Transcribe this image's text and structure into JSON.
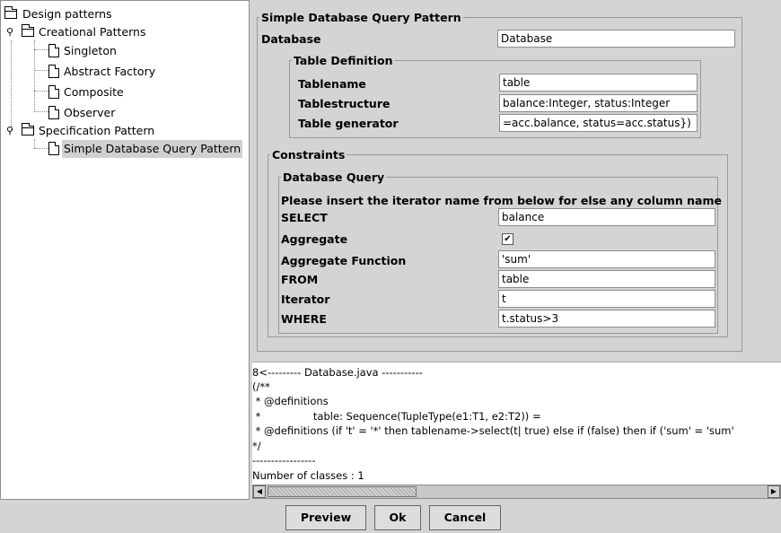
{
  "tree": {
    "items": [
      {
        "label": "Design patterns"
      },
      {
        "label": "Creational Patterns"
      },
      {
        "label": "Singleton"
      },
      {
        "label": "Abstract Factory"
      },
      {
        "label": "Composite"
      },
      {
        "label": "Observer"
      },
      {
        "label": "Specification Pattern"
      },
      {
        "label": "Simple Database Query Pattern"
      }
    ]
  },
  "form": {
    "title": "Simple Database Query Pattern",
    "database_label": "Database",
    "database_value": "Database",
    "table_def": {
      "title": "Table Definition",
      "tablename_label": "Tablename",
      "tablename_value": "table",
      "tablestructure_label": "Tablestructure",
      "tablestructure_value": "balance:Integer, status:Integer",
      "generator_label": "Table generator",
      "generator_value": "=acc.balance, status=acc.status})"
    },
    "constraints": {
      "title": "Constraints",
      "query_title": "Database Query",
      "instruction": "Please insert the iterator name from below for  else any column name",
      "select_label": "SELECT",
      "select_value": "balance",
      "aggregate_label": "Aggregate",
      "aggregate_checked": "✔",
      "aggfunc_label": "Aggregate Function",
      "aggfunc_value": "'sum'",
      "from_label": "FROM",
      "from_value": "table",
      "iterator_label": "Iterator",
      "iterator_value": "t",
      "where_label": "WHERE",
      "where_value": "t.status>3"
    }
  },
  "output": {
    "lines": [
      "8<--------- Database.java -----------",
      "(/**",
      " * @definitions",
      " *                table: Sequence(TupleType(e1:T1, e2:T2)) =",
      " * @definitions (if 't' = '*' then tablename->select(t| true) else if (false) then if ('sum' = 'sum'",
      "*/",
      "-----------------",
      "Number of classes : 1"
    ]
  },
  "buttons": {
    "preview": "Preview",
    "ok": "Ok",
    "cancel": "Cancel"
  }
}
